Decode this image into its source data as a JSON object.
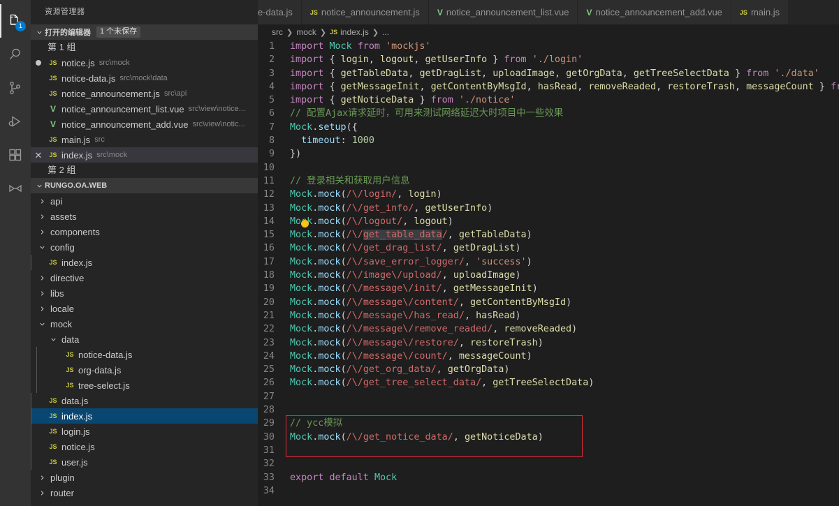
{
  "activitybar": {
    "items": [
      {
        "name": "explorer",
        "icon": "files-icon",
        "badge": "1",
        "active": true
      },
      {
        "name": "search",
        "icon": "search-icon",
        "badge": "",
        "active": false
      },
      {
        "name": "source-control",
        "icon": "source-control-icon",
        "badge": "",
        "active": false
      },
      {
        "name": "run-and-debug",
        "icon": "run-debug-icon",
        "badge": "",
        "active": false
      },
      {
        "name": "extensions",
        "icon": "extensions-icon",
        "badge": "",
        "active": false
      },
      {
        "name": "vue-tools",
        "icon": "vue-remote-icon",
        "badge": "",
        "active": false
      }
    ]
  },
  "sidebar": {
    "title": "资源管理器",
    "open_editors": {
      "label": "打开的编辑器",
      "unsaved_badge": "1 个未保存",
      "groups": [
        {
          "label": "第 1 组",
          "files": [
            {
              "name": "notice.js",
              "path": "src\\mock",
              "icon": "js",
              "state": "dirty"
            },
            {
              "name": "notice-data.js",
              "path": "src\\mock\\data",
              "icon": "js",
              "state": ""
            },
            {
              "name": "notice_announcement.js",
              "path": "src\\api",
              "icon": "js",
              "state": ""
            },
            {
              "name": "notice_announcement_list.vue",
              "path": "src\\view\\notice...",
              "icon": "vue",
              "state": ""
            },
            {
              "name": "notice_announcement_add.vue",
              "path": "src\\view\\notic...",
              "icon": "vue",
              "state": ""
            },
            {
              "name": "main.js",
              "path": "src",
              "icon": "js",
              "state": ""
            },
            {
              "name": "index.js",
              "path": "src\\mock",
              "icon": "js",
              "state": "close"
            }
          ]
        },
        {
          "label": "第 2 组",
          "files": []
        }
      ]
    },
    "project": {
      "label": "RUNGO.OA.WEB",
      "tree": [
        {
          "label": "api",
          "type": "folder",
          "depth": 1,
          "expanded": false,
          "selected": false
        },
        {
          "label": "assets",
          "type": "folder",
          "depth": 1,
          "expanded": false,
          "selected": false
        },
        {
          "label": "components",
          "type": "folder",
          "depth": 1,
          "expanded": false,
          "selected": false
        },
        {
          "label": "config",
          "type": "folder",
          "depth": 1,
          "expanded": true,
          "selected": false
        },
        {
          "label": "index.js",
          "type": "js",
          "depth": 2,
          "expanded": false,
          "selected": false
        },
        {
          "label": "directive",
          "type": "folder",
          "depth": 1,
          "expanded": false,
          "selected": false
        },
        {
          "label": "libs",
          "type": "folder",
          "depth": 1,
          "expanded": false,
          "selected": false
        },
        {
          "label": "locale",
          "type": "folder",
          "depth": 1,
          "expanded": false,
          "selected": false
        },
        {
          "label": "mock",
          "type": "folder",
          "depth": 1,
          "expanded": true,
          "selected": false
        },
        {
          "label": "data",
          "type": "folder",
          "depth": 2,
          "expanded": true,
          "selected": false
        },
        {
          "label": "notice-data.js",
          "type": "js",
          "depth": 3,
          "expanded": false,
          "selected": false
        },
        {
          "label": "org-data.js",
          "type": "js",
          "depth": 3,
          "expanded": false,
          "selected": false
        },
        {
          "label": "tree-select.js",
          "type": "js",
          "depth": 3,
          "expanded": false,
          "selected": false
        },
        {
          "label": "data.js",
          "type": "js",
          "depth": 2,
          "expanded": false,
          "selected": false
        },
        {
          "label": "index.js",
          "type": "js",
          "depth": 2,
          "expanded": false,
          "selected": true
        },
        {
          "label": "login.js",
          "type": "js",
          "depth": 2,
          "expanded": false,
          "selected": false
        },
        {
          "label": "notice.js",
          "type": "js",
          "depth": 2,
          "expanded": false,
          "selected": false
        },
        {
          "label": "user.js",
          "type": "js",
          "depth": 2,
          "expanded": false,
          "selected": false
        },
        {
          "label": "plugin",
          "type": "folder",
          "depth": 1,
          "expanded": false,
          "selected": false
        },
        {
          "label": "router",
          "type": "folder",
          "depth": 1,
          "expanded": false,
          "selected": false
        }
      ]
    }
  },
  "editor": {
    "tabs": [
      {
        "label": "e-data.js",
        "icon": "none",
        "truncated": true,
        "active": false
      },
      {
        "label": "notice_announcement.js",
        "icon": "js",
        "truncated": false,
        "active": false
      },
      {
        "label": "notice_announcement_list.vue",
        "icon": "vue",
        "truncated": false,
        "active": false
      },
      {
        "label": "notice_announcement_add.vue",
        "icon": "vue",
        "truncated": false,
        "active": false
      },
      {
        "label": "main.js",
        "icon": "js",
        "truncated": false,
        "active": false
      }
    ],
    "breadcrumbs": [
      {
        "label": "src",
        "icon": "none"
      },
      {
        "label": "mock",
        "icon": "none"
      },
      {
        "label": "index.js",
        "icon": "js"
      },
      {
        "label": "...",
        "icon": "none"
      }
    ],
    "first_line_number": 1,
    "last_line_number": 34,
    "lines": [
      {
        "n": 1,
        "text": "import Mock from 'mockjs'"
      },
      {
        "n": 2,
        "text": "import { login, logout, getUserInfo } from './login'"
      },
      {
        "n": 3,
        "text": "import { getTableData, getDragList, uploadImage, getOrgData, getTreeSelectData } from './data'"
      },
      {
        "n": 4,
        "text": "import { getMessageInit, getContentByMsgId, hasRead, removeReaded, restoreTrash, messageCount } from"
      },
      {
        "n": 5,
        "text": "import { getNoticeData } from './notice'"
      },
      {
        "n": 6,
        "text": "// 配置Ajax请求延时，可用来测试网络延迟大时项目中一些效果"
      },
      {
        "n": 7,
        "text": "Mock.setup({"
      },
      {
        "n": 8,
        "text": "  timeout: 1000"
      },
      {
        "n": 9,
        "text": "})"
      },
      {
        "n": 10,
        "text": ""
      },
      {
        "n": 11,
        "text": "// 登录相关和获取用户信息"
      },
      {
        "n": 12,
        "text": "Mock.mock(/\\/login/, login)"
      },
      {
        "n": 13,
        "text": "Mock.mock(/\\/get_info/, getUserInfo)"
      },
      {
        "n": 14,
        "text": "Mock.mock(/\\/logout/, logout)"
      },
      {
        "n": 15,
        "text": "Mock.mock(/\\/get_table_data/, getTableData)"
      },
      {
        "n": 16,
        "text": "Mock.mock(/\\/get_drag_list/, getDragList)"
      },
      {
        "n": 17,
        "text": "Mock.mock(/\\/save_error_logger/, 'success')"
      },
      {
        "n": 18,
        "text": "Mock.mock(/\\/image\\/upload/, uploadImage)"
      },
      {
        "n": 19,
        "text": "Mock.mock(/\\/message\\/init/, getMessageInit)"
      },
      {
        "n": 20,
        "text": "Mock.mock(/\\/message\\/content/, getContentByMsgId)"
      },
      {
        "n": 21,
        "text": "Mock.mock(/\\/message\\/has_read/, hasRead)"
      },
      {
        "n": 22,
        "text": "Mock.mock(/\\/message\\/remove_readed/, removeReaded)"
      },
      {
        "n": 23,
        "text": "Mock.mock(/\\/message\\/restore/, restoreTrash)"
      },
      {
        "n": 24,
        "text": "Mock.mock(/\\/message\\/count/, messageCount)"
      },
      {
        "n": 25,
        "text": "Mock.mock(/\\/get_org_data/, getOrgData)"
      },
      {
        "n": 26,
        "text": "Mock.mock(/\\/get_tree_select_data/, getTreeSelectData)"
      },
      {
        "n": 27,
        "text": ""
      },
      {
        "n": 28,
        "text": ""
      },
      {
        "n": 29,
        "text": "// ycc模拟"
      },
      {
        "n": 30,
        "text": "Mock.mock(/\\/get_notice_data/, getNoticeData)"
      },
      {
        "n": 31,
        "text": ""
      },
      {
        "n": 32,
        "text": ""
      },
      {
        "n": 33,
        "text": "export default Mock"
      },
      {
        "n": 34,
        "text": ""
      }
    ],
    "selection_text": "get_table_data",
    "selection_line": 15,
    "cursor_line": 14,
    "annotation": {
      "color": "#e02b3a",
      "from_line": 29,
      "to_line": 31
    }
  },
  "colors": {
    "accent": "#007acc",
    "selection_blue": "#094771",
    "editor_bg": "#1e1e1e",
    "sidebar_bg": "#252526",
    "activitybar_bg": "#333333",
    "annotation_red": "#e02b3a",
    "cursor_yellow": "#f5c518"
  }
}
